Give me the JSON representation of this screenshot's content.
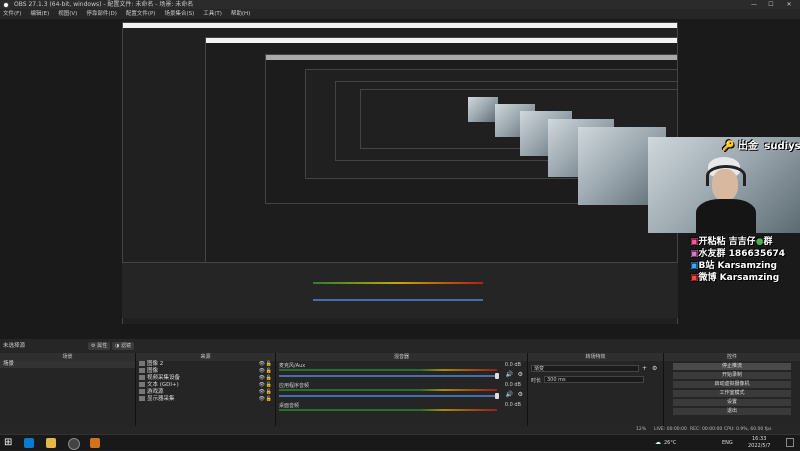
{
  "window": {
    "title": "OBS 27.1.3 (64-bit, windows) - 配置文件: 未命名 - 场景: 未命名",
    "minimize": "—",
    "maximize": "☐",
    "close": "✕"
  },
  "menu": [
    "文件(F)",
    "编辑(E)",
    "视图(V)",
    "停靠部件(D)",
    "配置文件(P)",
    "场景集合(S)",
    "工具(T)",
    "帮助(H)"
  ],
  "overlay": {
    "streamer_tag": "出金",
    "streamer_name": "sudiys",
    "lines": [
      {
        "icon": "kuaishou-icon",
        "label": "开粘粘",
        "text": "吉吉仔",
        "suffix": "群"
      },
      {
        "icon": "fans-group-icon",
        "label": "水友群",
        "text": "186635674"
      },
      {
        "icon": "bilibili-icon",
        "label": "B站",
        "text": "Karsamzing"
      },
      {
        "icon": "weibo-icon",
        "label": "微博",
        "text": "Karsamzing"
      }
    ]
  },
  "status": {
    "selected_source": "未选择源",
    "properties_btn": "属性",
    "filters_btn": "滤镜"
  },
  "scenes_dock": {
    "header": "场景",
    "items": [
      "场景"
    ],
    "footer": "+ − ∧ ∨"
  },
  "sources_dock": {
    "header": "来源",
    "items": [
      {
        "name": "图像 2"
      },
      {
        "name": "图像"
      },
      {
        "name": "视频采集设备"
      },
      {
        "name": "文本 (GDI+)"
      },
      {
        "name": "游戏源"
      },
      {
        "name": "显示器采集"
      }
    ],
    "footer": "+ − ⚙ ∧ ∨"
  },
  "mixer_dock": {
    "header": "混音器",
    "channels": [
      {
        "name": "麦克风/Aux",
        "db": "0.0 dB"
      },
      {
        "name": "应用程序音频",
        "db": "0.0 dB"
      },
      {
        "name": "桌面音频",
        "db": "0.0 dB"
      }
    ]
  },
  "transition_dock": {
    "header": "转场特效",
    "type": "渐变",
    "duration_label": "时长",
    "duration_value": "300 ms"
  },
  "controls_dock": {
    "header": "控件",
    "buttons": [
      "停止推流",
      "开始录制",
      "启动虚拟摄像机",
      "工作室模式",
      "设置",
      "退出"
    ]
  },
  "stats": {
    "live": "LIVE: 00:00:00",
    "rec": "REC: 00:00:00",
    "cpu": "CPU: 0.9%, 60.00 fps",
    "frames": "12%"
  },
  "taskbar": {
    "weather": "26°C",
    "lang": "ENG",
    "time": "16:33",
    "date": "2022/5/7"
  }
}
